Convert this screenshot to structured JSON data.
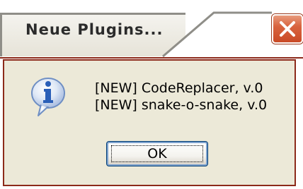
{
  "window": {
    "title": "Neue Plugins..."
  },
  "message": {
    "lines": [
      "[NEW]  CodeReplacer, v.0",
      "[NEW]  snake-o-snake, v.0"
    ]
  },
  "buttons": {
    "ok_label": "OK"
  },
  "icons": {
    "message_icon": "info-icon",
    "close": "close-icon"
  },
  "colors": {
    "close_button": "#d9643f",
    "info_icon": "#2a5fb8",
    "dialog_border": "#8c2a1a",
    "dialog_background": "#ece9d8"
  }
}
